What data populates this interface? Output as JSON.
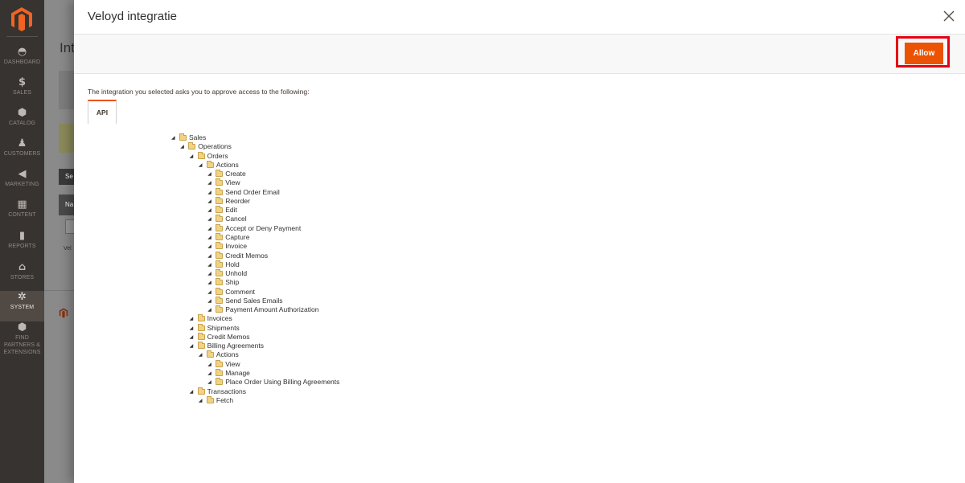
{
  "sidebar": {
    "items": [
      {
        "label": "DASHBOARD",
        "glyph": "◓",
        "icon": "dashboard-icon"
      },
      {
        "label": "SALES",
        "glyph": "$",
        "icon": "dollar-icon"
      },
      {
        "label": "CATALOG",
        "glyph": "⬢",
        "icon": "catalog-cube-icon"
      },
      {
        "label": "CUSTOMERS",
        "glyph": "♟",
        "icon": "customers-person-icon"
      },
      {
        "label": "MARKETING",
        "glyph": "◀",
        "icon": "megaphone-icon"
      },
      {
        "label": "CONTENT",
        "glyph": "▦",
        "icon": "content-layout-icon"
      },
      {
        "label": "REPORTS",
        "glyph": "▮",
        "icon": "bar-chart-icon"
      },
      {
        "label": "STORES",
        "glyph": "⌂",
        "icon": "store-icon"
      },
      {
        "label": "SYSTEM",
        "glyph": "✲",
        "icon": "gear-icon"
      },
      {
        "label": "FIND PARTNERS & EXTENSIONS",
        "glyph": "⬢",
        "icon": "partners-cube-icon"
      }
    ]
  },
  "background": {
    "page_title_fragment": "Int",
    "button_fragment": "Se",
    "table_header_fragment": "Na",
    "row_fragment": "Vel"
  },
  "modal": {
    "title": "Veloyd integratie",
    "allow_label": "Allow",
    "intro": "The integration you selected asks you to approve access to the following:",
    "tab_label": "API"
  },
  "colors": {
    "accent": "#eb5202",
    "highlight": "#e60012",
    "sidebar": "#373330"
  },
  "tree": [
    {
      "label": "Sales",
      "depth": 0
    },
    {
      "label": "Operations",
      "depth": 1
    },
    {
      "label": "Orders",
      "depth": 2
    },
    {
      "label": "Actions",
      "depth": 3
    },
    {
      "label": "Create",
      "depth": 4
    },
    {
      "label": "View",
      "depth": 4
    },
    {
      "label": "Send Order Email",
      "depth": 4
    },
    {
      "label": "Reorder",
      "depth": 4
    },
    {
      "label": "Edit",
      "depth": 4
    },
    {
      "label": "Cancel",
      "depth": 4
    },
    {
      "label": "Accept or Deny Payment",
      "depth": 4
    },
    {
      "label": "Capture",
      "depth": 4
    },
    {
      "label": "Invoice",
      "depth": 4
    },
    {
      "label": "Credit Memos",
      "depth": 4
    },
    {
      "label": "Hold",
      "depth": 4
    },
    {
      "label": "Unhold",
      "depth": 4
    },
    {
      "label": "Ship",
      "depth": 4
    },
    {
      "label": "Comment",
      "depth": 4
    },
    {
      "label": "Send Sales Emails",
      "depth": 4
    },
    {
      "label": "Payment Amount Authorization",
      "depth": 4
    },
    {
      "label": "Invoices",
      "depth": 2
    },
    {
      "label": "Shipments",
      "depth": 2
    },
    {
      "label": "Credit Memos",
      "depth": 2
    },
    {
      "label": "Billing Agreements",
      "depth": 2
    },
    {
      "label": "Actions",
      "depth": 3
    },
    {
      "label": "View",
      "depth": 4
    },
    {
      "label": "Manage",
      "depth": 4
    },
    {
      "label": "Place Order Using Billing Agreements",
      "depth": 4
    },
    {
      "label": "Transactions",
      "depth": 2
    },
    {
      "label": "Fetch",
      "depth": 3
    }
  ]
}
